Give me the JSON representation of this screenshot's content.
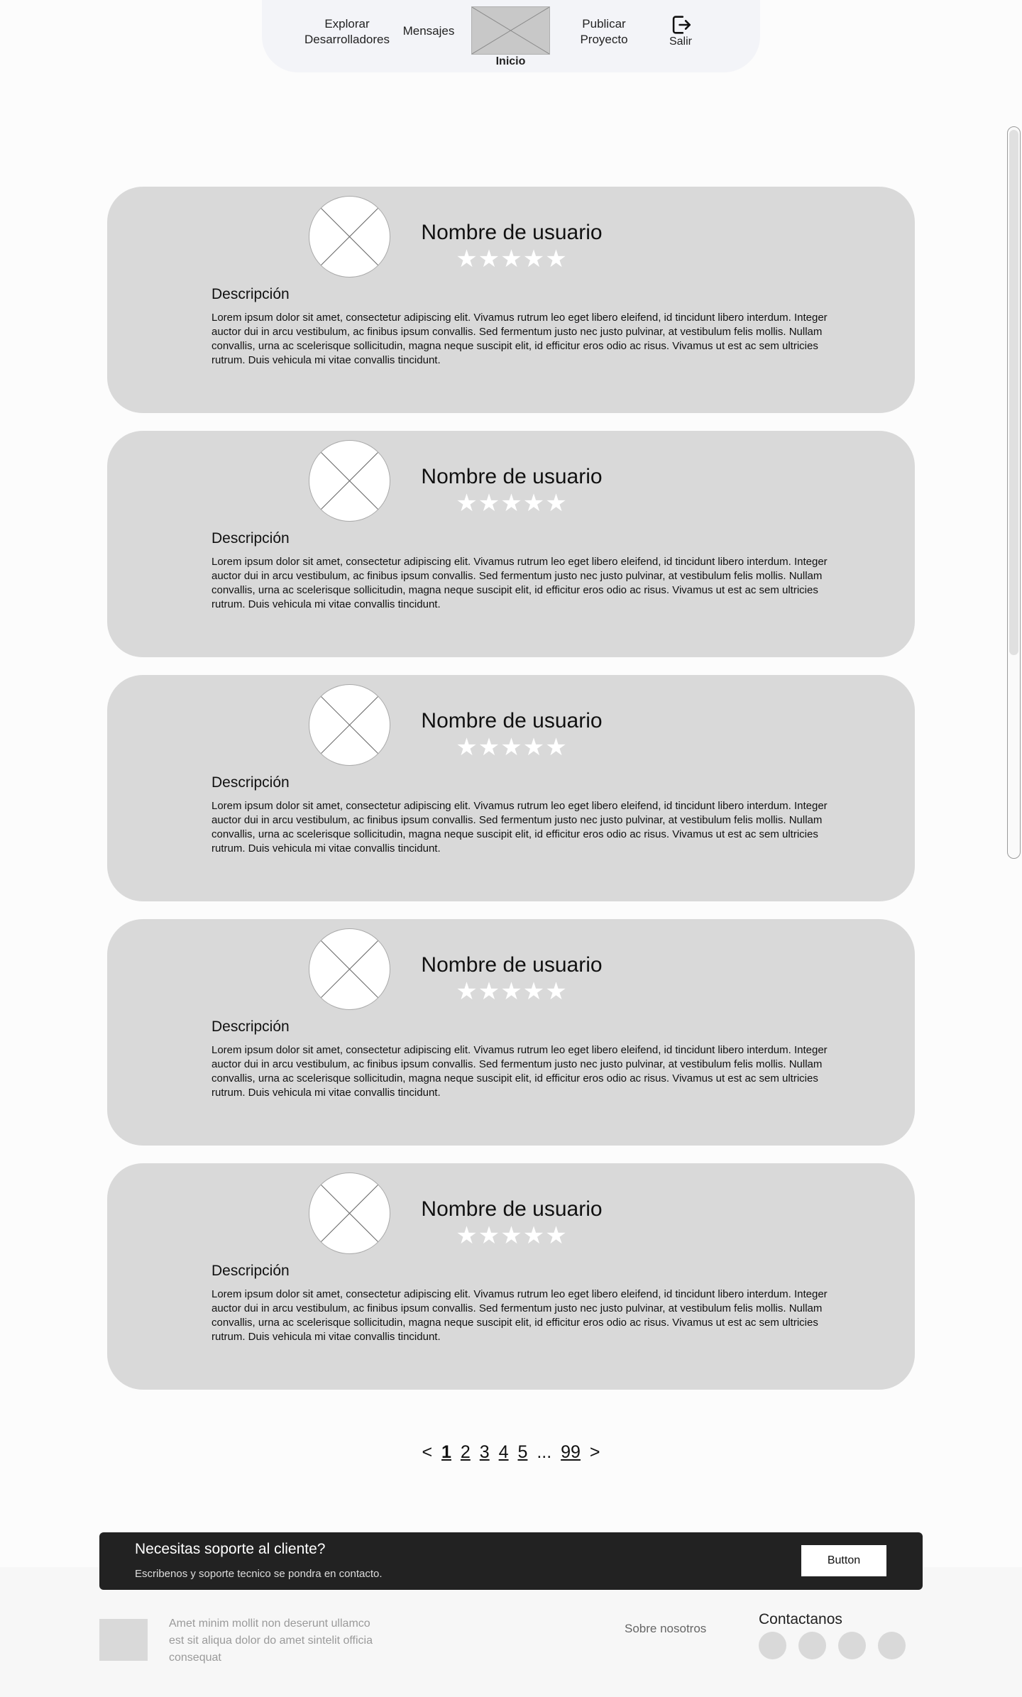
{
  "nav": {
    "explore_label": "Explorar Desarrolladores",
    "messages_label": "Mensajes",
    "home_label": "Inicio",
    "publish_label": "Publicar Proyecto",
    "exit_label": "Salir"
  },
  "cards": [
    {
      "username": "Nombre de usuario",
      "stars": "★★★★★",
      "desc_title": "Descripción",
      "desc": "Lorem ipsum dolor sit amet, consectetur adipiscing elit. Vivamus rutrum leo eget libero eleifend, id tincidunt libero interdum. Integer auctor dui in arcu vestibulum, ac finibus ipsum convallis. Sed fermentum justo nec justo pulvinar, at vestibulum felis mollis. Nullam convallis, urna ac scelerisque sollicitudin, magna neque suscipit elit, id efficitur eros odio ac risus. Vivamus ut est ac sem ultricies rutrum. Duis vehicula mi vitae convallis tincidunt."
    },
    {
      "username": "Nombre de usuario",
      "stars": "★★★★★",
      "desc_title": "Descripción",
      "desc": "Lorem ipsum dolor sit amet, consectetur adipiscing elit. Vivamus rutrum leo eget libero eleifend, id tincidunt libero interdum. Integer auctor dui in arcu vestibulum, ac finibus ipsum convallis. Sed fermentum justo nec justo pulvinar, at vestibulum felis mollis. Nullam convallis, urna ac scelerisque sollicitudin, magna neque suscipit elit, id efficitur eros odio ac risus. Vivamus ut est ac sem ultricies rutrum. Duis vehicula mi vitae convallis tincidunt."
    },
    {
      "username": "Nombre de usuario",
      "stars": "★★★★★",
      "desc_title": "Descripción",
      "desc": "Lorem ipsum dolor sit amet, consectetur adipiscing elit. Vivamus rutrum leo eget libero eleifend, id tincidunt libero interdum. Integer auctor dui in arcu vestibulum, ac finibus ipsum convallis. Sed fermentum justo nec justo pulvinar, at vestibulum felis mollis. Nullam convallis, urna ac scelerisque sollicitudin, magna neque suscipit elit, id efficitur eros odio ac risus. Vivamus ut est ac sem ultricies rutrum. Duis vehicula mi vitae convallis tincidunt."
    },
    {
      "username": "Nombre de usuario",
      "stars": "★★★★★",
      "desc_title": "Descripción",
      "desc": "Lorem ipsum dolor sit amet, consectetur adipiscing elit. Vivamus rutrum leo eget libero eleifend, id tincidunt libero interdum. Integer auctor dui in arcu vestibulum, ac finibus ipsum convallis. Sed fermentum justo nec justo pulvinar, at vestibulum felis mollis. Nullam convallis, urna ac scelerisque sollicitudin, magna neque suscipit elit, id efficitur eros odio ac risus. Vivamus ut est ac sem ultricies rutrum. Duis vehicula mi vitae convallis tincidunt."
    },
    {
      "username": "Nombre de usuario",
      "stars": "★★★★★",
      "desc_title": "Descripción",
      "desc": "Lorem ipsum dolor sit amet, consectetur adipiscing elit. Vivamus rutrum leo eget libero eleifend, id tincidunt libero interdum. Integer auctor dui in arcu vestibulum, ac finibus ipsum convallis. Sed fermentum justo nec justo pulvinar, at vestibulum felis mollis. Nullam convallis, urna ac scelerisque sollicitudin, magna neque suscipit elit, id efficitur eros odio ac risus. Vivamus ut est ac sem ultricies rutrum. Duis vehicula mi vitae convallis tincidunt."
    }
  ],
  "pagination": {
    "prev": "<",
    "pages": [
      "1",
      "2",
      "3",
      "4",
      "5"
    ],
    "ellipsis": "...",
    "last": "99",
    "next": ">"
  },
  "support": {
    "title": "Necesitas soporte al cliente?",
    "subtitle": "Escribenos y soporte tecnico se pondra en contacto.",
    "button_label": "Button"
  },
  "footer": {
    "text": "Amet minim mollit non deserunt ullamco est sit aliqua dolor do amet sintelit officia consequat",
    "about_label": "Sobre nosotros",
    "contact_title": "Contactanos"
  },
  "colors": {
    "card_bg": "#d9d9d9",
    "nav_bg": "#f3f4f8",
    "support_bg": "#222222"
  }
}
